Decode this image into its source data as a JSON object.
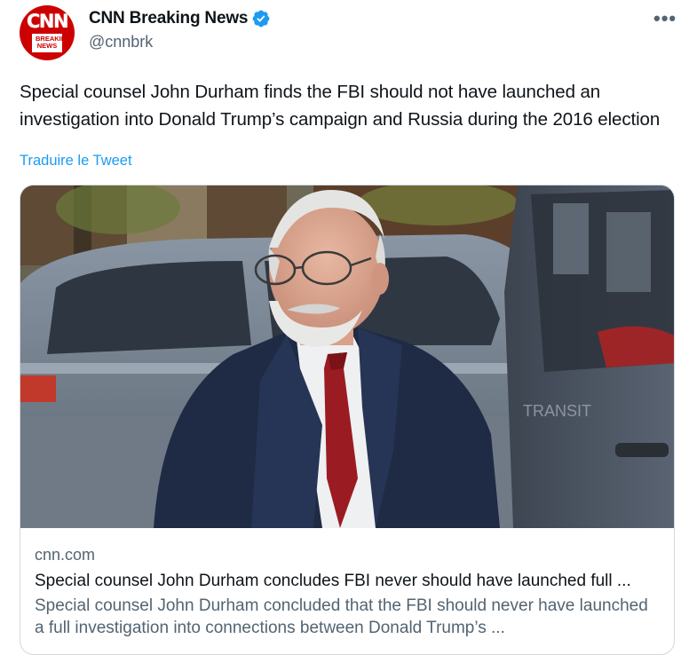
{
  "author": {
    "display_name": "CNN Breaking News",
    "handle": "@cnnbrk",
    "avatar_text": "CNN",
    "avatar_subtext": "BREAKING NEWS",
    "verified": true
  },
  "tweet": {
    "text": "Special counsel John Durham finds the FBI should not have launched an investigation into Donald Trump’s campaign and Russia during the 2016 election",
    "translate_label": "Traduire le Tweet",
    "more_label": "•••"
  },
  "card": {
    "domain": "cnn.com",
    "title": "Special counsel John Durham concludes FBI never should have launched full ...",
    "description": "Special counsel John Durham concluded that the FBI should never have launched a full investigation into connections between Donald Trump’s ..."
  },
  "colors": {
    "brand_red": "#cc0000",
    "link_blue": "#1d9bf0",
    "verified_blue": "#1d9bf0",
    "secondary_text": "#536471"
  },
  "icons": {
    "verified": "verified-badge-icon",
    "more": "more-options-icon"
  }
}
